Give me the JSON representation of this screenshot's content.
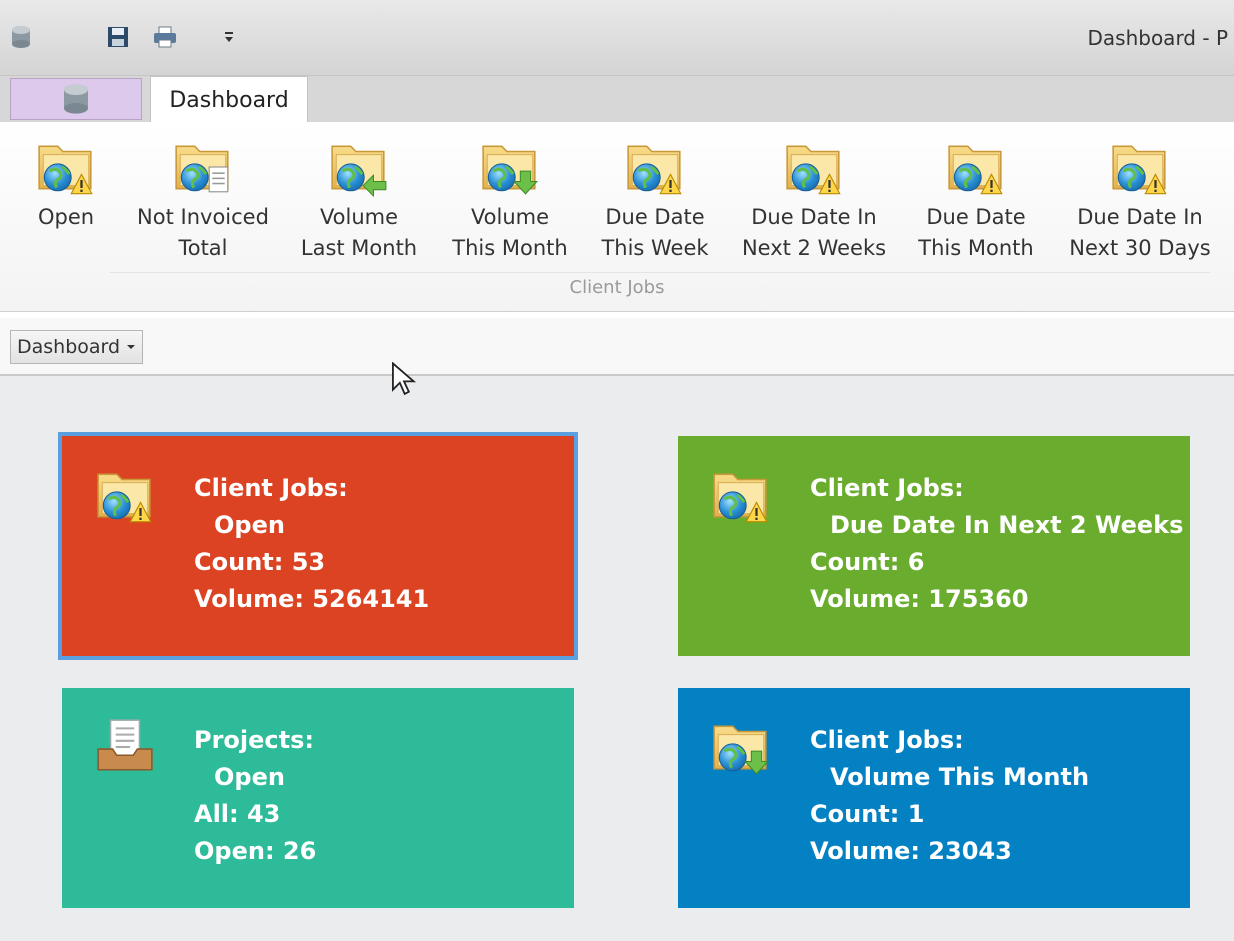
{
  "window": {
    "title": "Dashboard - P"
  },
  "tabs": {
    "active": "Dashboard"
  },
  "ribbon": {
    "buttons": [
      {
        "line1": "Open",
        "line2": "",
        "icon": "folder-globe-warning-icon"
      },
      {
        "line1": "Not Invoiced",
        "line2": "Total",
        "icon": "folder-globe-document-icon"
      },
      {
        "line1": "Volume",
        "line2": "Last Month",
        "icon": "folder-globe-arrow-left-icon"
      },
      {
        "line1": "Volume",
        "line2": "This Month",
        "icon": "folder-globe-arrow-down-icon"
      },
      {
        "line1": "Due Date",
        "line2": "This Week",
        "icon": "folder-globe-warning-icon"
      },
      {
        "line1": "Due Date In",
        "line2": "Next 2 Weeks",
        "icon": "folder-globe-warning-icon"
      },
      {
        "line1": "Due Date",
        "line2": "This Month",
        "icon": "folder-globe-warning-icon"
      },
      {
        "line1": "Due Date In",
        "line2": "Next 30 Days",
        "icon": "folder-globe-warning-icon"
      }
    ],
    "group_label": "Client Jobs"
  },
  "subbar": {
    "dropdown_label": "Dashboard"
  },
  "tiles": [
    {
      "heading": "Client Jobs:",
      "sub": "Open",
      "line3": "Count: 53",
      "line4": "Volume: 5264141",
      "color": "#dc4323",
      "icon": "folder-globe-warning-icon"
    },
    {
      "heading": "Client Jobs:",
      "sub": "Due Date In Next 2 Weeks",
      "line3": "Count: 6",
      "line4": "Volume: 175360",
      "color": "#6aac2d",
      "icon": "folder-globe-warning-icon"
    },
    {
      "heading": "Projects:",
      "sub": "Open",
      "line3": "All: 43",
      "line4": "Open: 26",
      "color": "#2ebb99",
      "icon": "document-tray-icon"
    },
    {
      "heading": "Client Jobs:",
      "sub": "Volume This Month",
      "line3": "Count: 1",
      "line4": "Volume: 23043",
      "color": "#0481c2",
      "icon": "folder-globe-arrow-down-icon"
    }
  ]
}
